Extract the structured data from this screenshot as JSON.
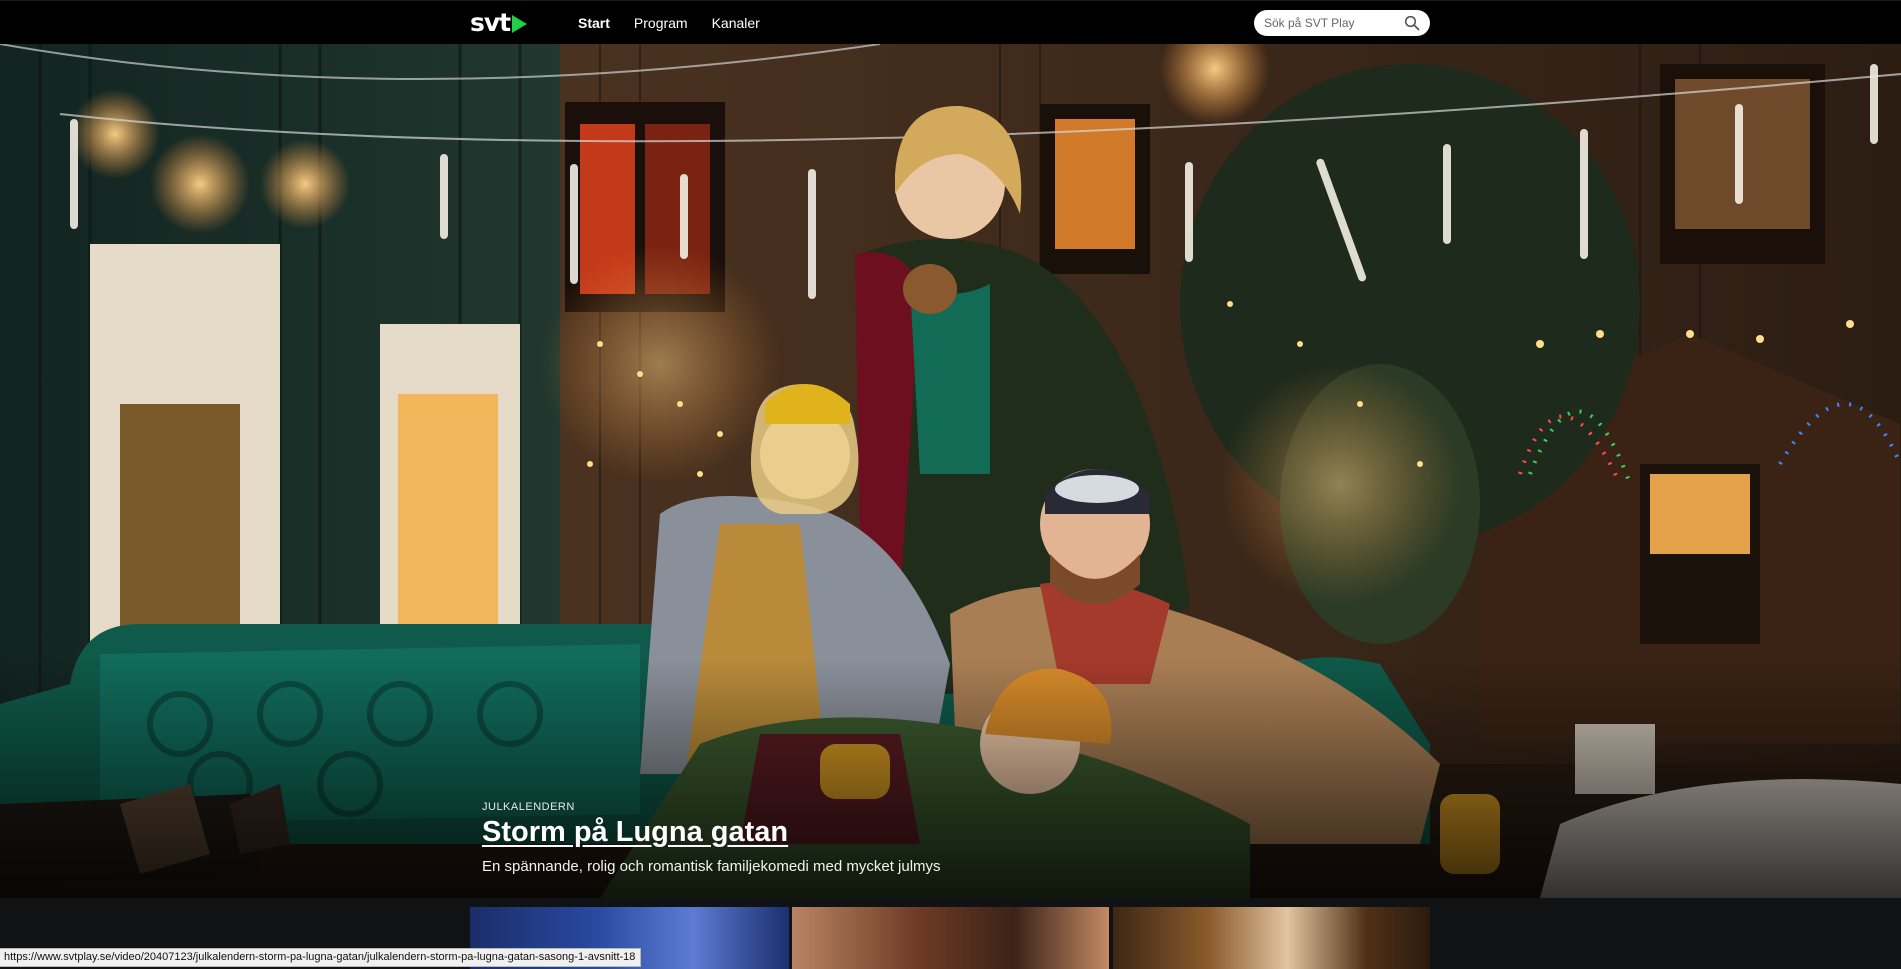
{
  "header": {
    "logo_text": "svt",
    "nav": [
      {
        "label": "Start",
        "active": true
      },
      {
        "label": "Program",
        "active": false
      },
      {
        "label": "Kanaler",
        "active": false
      }
    ],
    "search": {
      "placeholder": "Sök på SVT Play",
      "value": ""
    }
  },
  "hero": {
    "kicker": "JULKALENDERN",
    "title": "Storm på Lugna gatan",
    "description": "En spännande, rolig och romantisk familjekomedi med mycket julmys"
  },
  "status_bar": {
    "url": "https://www.svtplay.se/video/20407123/julkalendern-storm-pa-lugna-gatan/julkalendern-storm-pa-lugna-gatan-sasong-1-avsnitt-18"
  },
  "colors": {
    "logo_play": "#1fcf4a",
    "header_bg": "#000000",
    "row_bg": "#101214"
  },
  "icons": [
    "play-triangle-icon",
    "search-icon"
  ]
}
